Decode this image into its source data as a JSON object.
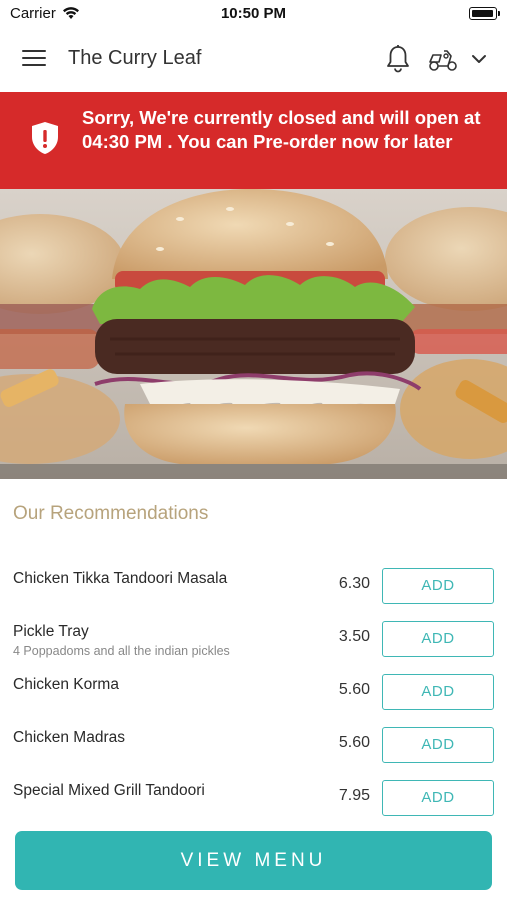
{
  "status_bar": {
    "carrier": "Carrier",
    "time": "10:50 PM"
  },
  "header": {
    "title": "The Curry Leaf",
    "icons": [
      "menu-icon",
      "bell-icon",
      "scooter-icon",
      "chevron-down-icon"
    ]
  },
  "banner": {
    "message": "Sorry, We're currently closed and will open at 04:30 PM . You can Pre-order now for later",
    "color": "#d62a2a",
    "icon": "shield-alert-icon"
  },
  "recommendations": {
    "title": "Our Recommendations",
    "add_label": "ADD",
    "items": [
      {
        "name": "Chicken Tikka Tandoori Masala",
        "description": "",
        "price": "6.30"
      },
      {
        "name": "Pickle Tray",
        "description": "4 Poppadoms and all the indian pickles",
        "price": "3.50"
      },
      {
        "name": "Chicken Korma",
        "description": "",
        "price": "5.60"
      },
      {
        "name": "Chicken Madras",
        "description": "",
        "price": "5.60"
      },
      {
        "name": "Special Mixed Grill Tandoori",
        "description": "",
        "price": "7.95"
      }
    ]
  },
  "footer": {
    "view_menu_label": "VIEW MENU"
  },
  "colors": {
    "accent": "#31b5b2",
    "banner": "#d62a2a",
    "section_title": "#b7a37c"
  }
}
